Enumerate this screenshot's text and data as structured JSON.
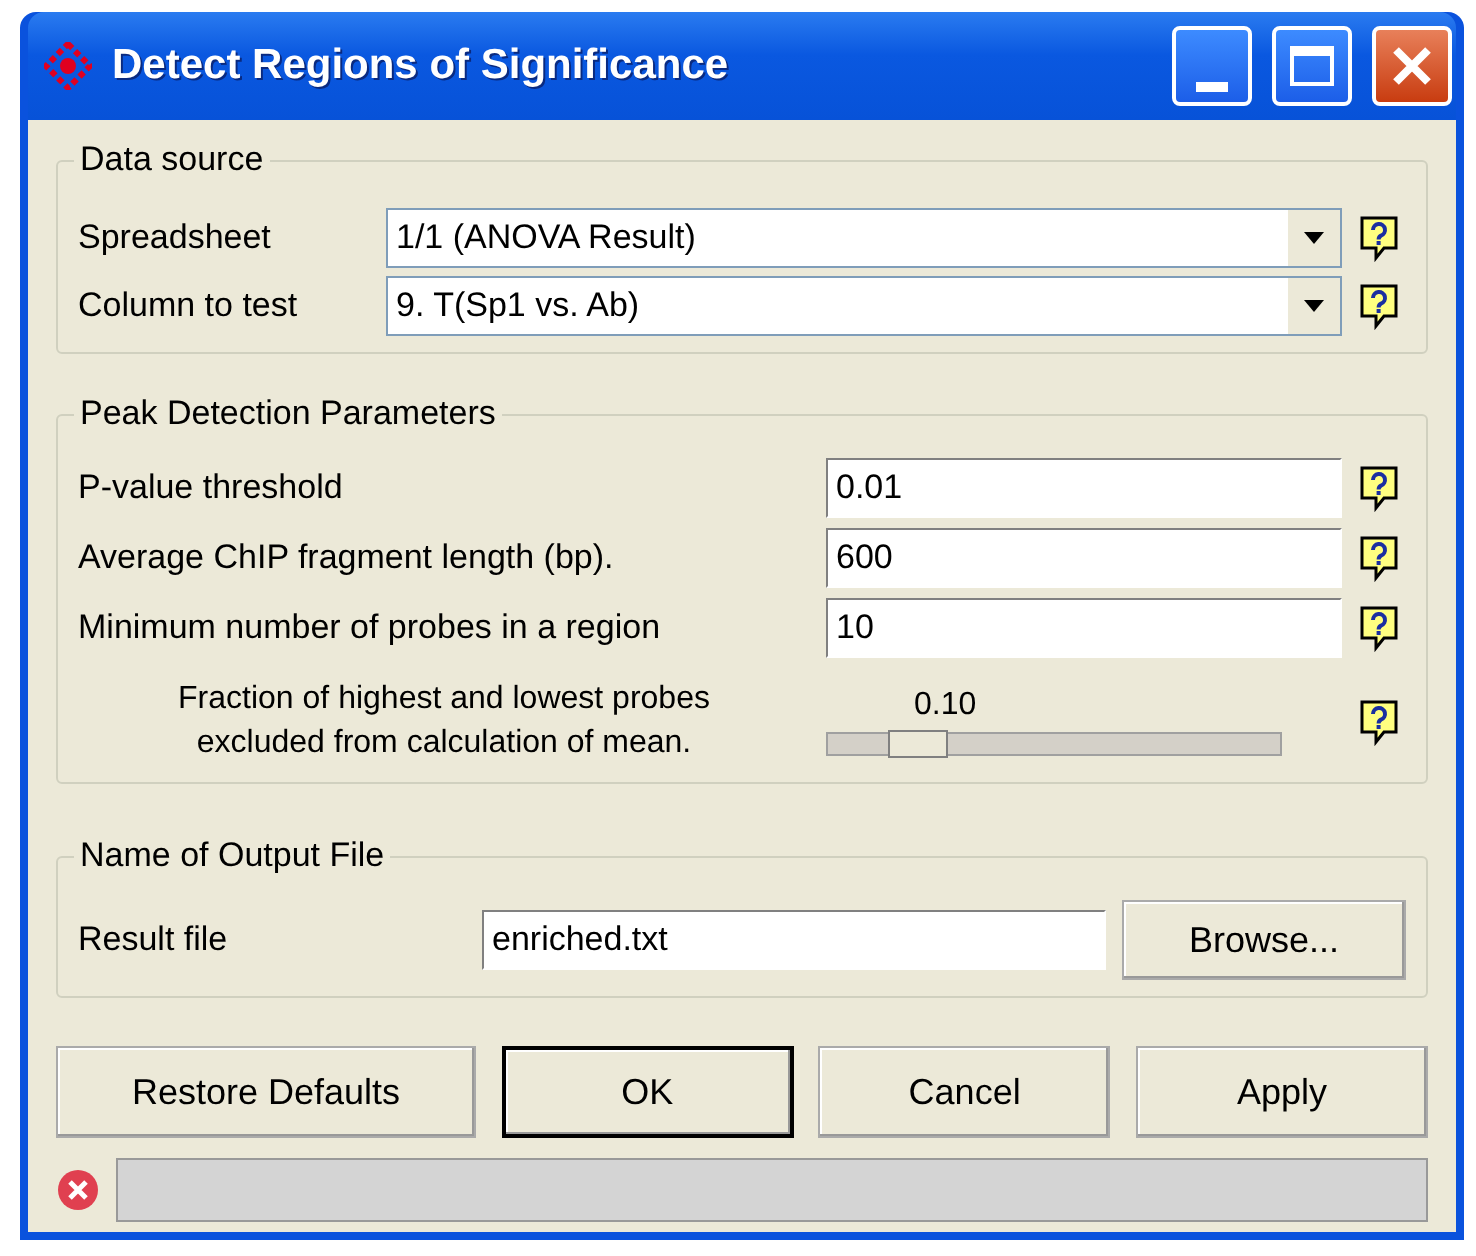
{
  "window": {
    "title": "Detect Regions of Significance"
  },
  "data_source": {
    "title": "Data source",
    "rows": [
      {
        "label": "Spreadsheet",
        "value": "1/1 (ANOVA Result)"
      },
      {
        "label": "Column to test",
        "value": "9. T(Sp1 vs. Ab)"
      }
    ]
  },
  "peak_detection": {
    "title": "Peak Detection Parameters",
    "rows": [
      {
        "kind": "field",
        "label": "P-value threshold",
        "value": "0.01"
      },
      {
        "kind": "field",
        "label": "Average ChIP fragment length (bp).",
        "value": "600"
      },
      {
        "kind": "field",
        "label": "Minimum number of probes in a region",
        "value": "10"
      },
      {
        "kind": "slider",
        "label": "Fraction of highest and lowest probes excluded from calculation of mean.",
        "reading": "0.10",
        "level": 0.2
      }
    ]
  },
  "output": {
    "title": "Name of Output File",
    "label": "Result file",
    "value": "enriched.txt",
    "button": "Browse..."
  },
  "buttons": [
    {
      "label": "Restore Defaults",
      "default": false
    },
    {
      "label": "OK",
      "default": true
    },
    {
      "label": "Cancel",
      "default": false
    },
    {
      "label": "Apply",
      "default": false
    }
  ]
}
